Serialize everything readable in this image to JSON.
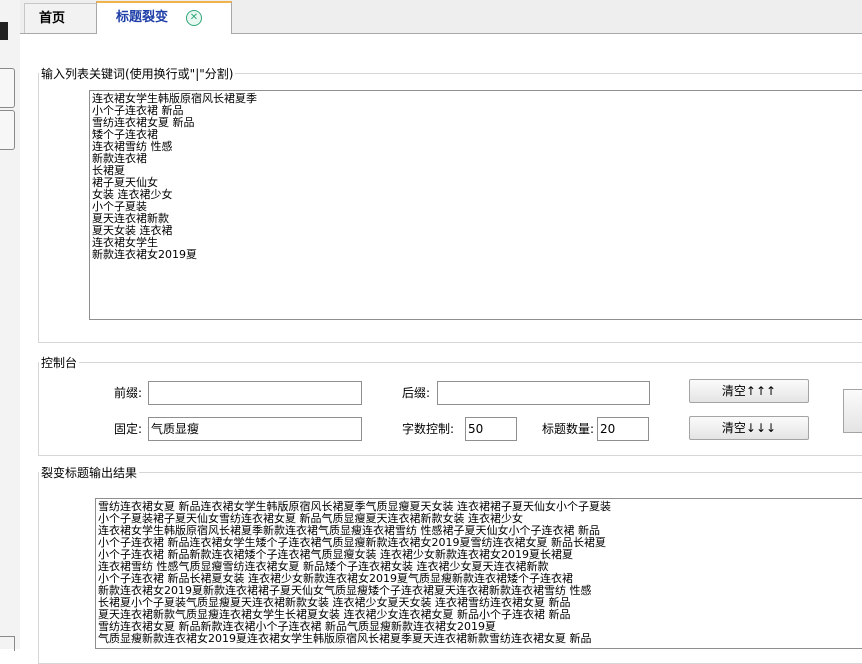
{
  "tabs": [
    {
      "label": "首页"
    },
    {
      "label": "标题裂变"
    }
  ],
  "input_section": {
    "legend": "输入列表关键词(使用换行或\"|\"分割)",
    "lines": [
      "连衣裙女学生韩版原宿风长裙夏季",
      "小个子连衣裙 新品",
      "雪纺连衣裙女夏 新品",
      "矮个子连衣裙",
      "连衣裙雪纺 性感",
      "新款连衣裙",
      "长裙夏",
      "裙子夏天仙女",
      "女装 连衣裙少女",
      "小个子夏装",
      "夏天连衣裙新款",
      "夏天女装 连衣裙",
      "连衣裙女学生",
      "新款连衣裙女2019夏"
    ]
  },
  "control": {
    "legend": "控制台",
    "prefix_label": "前缀:",
    "prefix_value": "",
    "suffix_label": "后缀:",
    "suffix_value": "",
    "fixed_label": "固定:",
    "fixed_value": "气质显瘦",
    "word_count_label": "字数控制:",
    "word_count_value": "50",
    "title_count_label": "标题数量:",
    "title_count_value": "20",
    "clear_up_label": "清空↑↑↑",
    "clear_down_label": "清空↓↓↓"
  },
  "output_section": {
    "legend": "裂变标题输出结果",
    "lines": [
      "雪纺连衣裙女夏 新品连衣裙女学生韩版原宿风长裙夏季气质显瘦夏天女装 连衣裙裙子夏天仙女小个子夏装",
      "小个子夏装裙子夏天仙女雪纺连衣裙女夏 新品气质显瘦夏天连衣裙新款女装 连衣裙少女",
      "连衣裙女学生韩版原宿风长裙夏季新款连衣裙气质显瘦连衣裙雪纺 性感裙子夏天仙女小个子连衣裙 新品",
      "小个子连衣裙 新品连衣裙女学生矮个子连衣裙气质显瘦新款连衣裙女2019夏雪纺连衣裙女夏 新品长裙夏",
      "小个子连衣裙 新品新款连衣裙矮个子连衣裙气质显瘦女装 连衣裙少女新款连衣裙女2019夏长裙夏",
      "连衣裙雪纺 性感气质显瘦雪纺连衣裙女夏 新品矮个子连衣裙女装 连衣裙少女夏天连衣裙新款",
      "小个子连衣裙 新品长裙夏女装 连衣裙少女新款连衣裙女2019夏气质显瘦新款连衣裙矮个子连衣裙",
      "新款连衣裙女2019夏新款连衣裙裙子夏天仙女气质显瘦矮个子连衣裙夏天连衣裙新款连衣裙雪纺 性感",
      "长裙夏小个子夏装气质显瘦夏天连衣裙新款女装 连衣裙少女夏天女装 连衣裙雪纺连衣裙女夏 新品",
      "夏天连衣裙新款气质显瘦连衣裙女学生长裙夏女装 连衣裙少女连衣裙女夏 新品小个子连衣裙 新品",
      "雪纺连衣裙女夏 新品新款连衣裙小个子连衣裙 新品气质显瘦新款连衣裙女2019夏",
      "气质显瘦新款连衣裙女2019夏连衣裙女学生韩版原宿风长裙夏季夏天连衣裙新款雪纺连衣裙女夏 新品"
    ]
  }
}
